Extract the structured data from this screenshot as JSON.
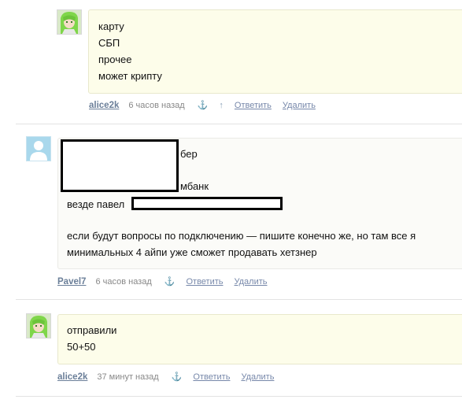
{
  "comments": [
    {
      "avatar_icon": "anime-character-green-hair-icon",
      "lines": [
        "карту",
        "СБП",
        "прочее",
        "может крипту"
      ],
      "author": "alice2k",
      "time": "6 часов назад",
      "anchor_icon": "⚓",
      "up_icon": "↑",
      "reply_label": "Ответить",
      "delete_label": "Удалить"
    },
    {
      "avatar_icon": "default-user-silhouette-icon",
      "lines": [
        "бер",
        "мбанк",
        "везде павел",
        "",
        "если будут вопросы по подключению — пишите конечно же, но там все я",
        "минимальных 4 айпи уже сможет продавать хетзнер"
      ],
      "author": "Pavel7",
      "time": "6 часов назад",
      "anchor_icon": "⚓",
      "reply_label": "Ответить",
      "delete_label": "Удалить"
    },
    {
      "avatar_icon": "anime-character-green-hair-icon",
      "lines": [
        "отправили",
        "50+50"
      ],
      "author": "alice2k",
      "time": "37 минут назад",
      "anchor_icon": "⚓",
      "reply_label": "Ответить",
      "delete_label": "Удалить"
    }
  ],
  "colors": {
    "bubble_bg": "#fdfdea",
    "bubble_border": "#e8e8cc",
    "author_link": "#6b7f99",
    "action_link": "#7788aa",
    "avatar_hair_green": "#7fd64a",
    "default_avatar_blue": "#a9d8ec"
  }
}
